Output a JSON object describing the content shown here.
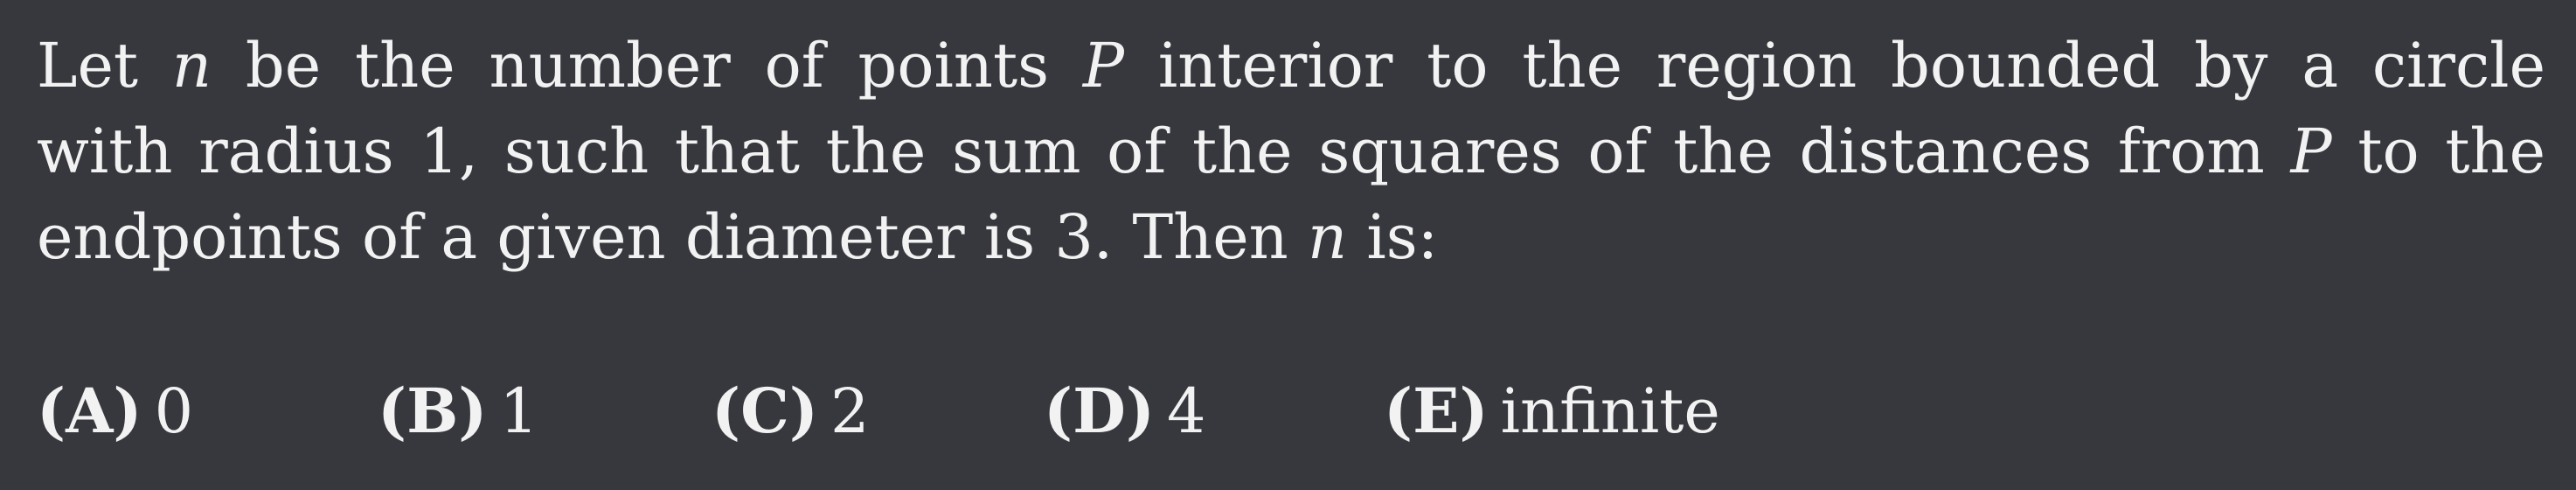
{
  "problem": {
    "line1": {
      "before_n": "Let ",
      "var_n": "n",
      "between": " be the number of points ",
      "var_P": "P",
      "after": " interior to the region bounded by a circle"
    },
    "line2": {
      "before_P": "with radius 1, such that the sum of the squares of the distances from ",
      "var_P": "P",
      "after": " to the"
    },
    "line3": {
      "before_n": "endpoints of a given diameter is 3.  Then ",
      "var_n": "n",
      "after": " is:"
    }
  },
  "choices": [
    {
      "label": "(A)",
      "value": "0"
    },
    {
      "label": "(B)",
      "value": "1"
    },
    {
      "label": "(C)",
      "value": "2"
    },
    {
      "label": "(D)",
      "value": "4"
    },
    {
      "label": "(E)",
      "value": "infinite"
    }
  ]
}
